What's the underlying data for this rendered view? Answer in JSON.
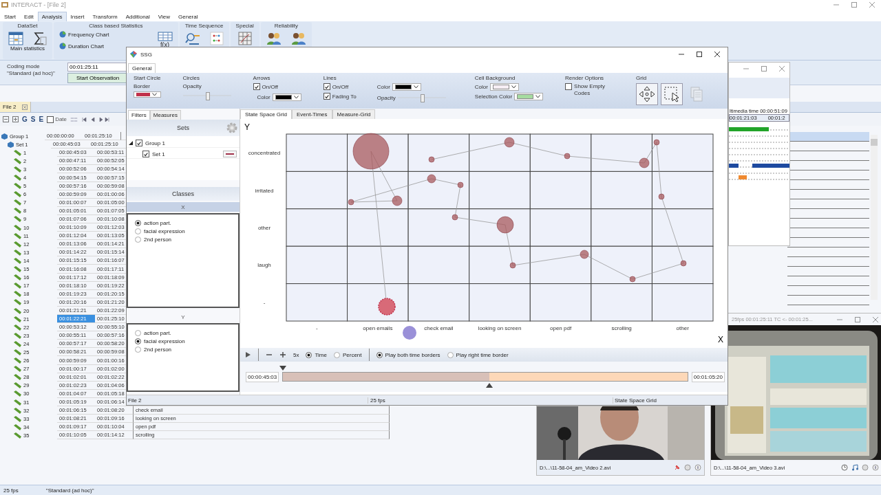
{
  "app": {
    "title": "INTERACT - [File 2]"
  },
  "menu": [
    {
      "label": "Start",
      "selected": false
    },
    {
      "label": "Edit",
      "selected": false
    },
    {
      "label": "Analysis",
      "selected": true
    },
    {
      "label": "Insert",
      "selected": false
    },
    {
      "label": "Transform",
      "selected": false
    },
    {
      "label": "Additional",
      "selected": false
    },
    {
      "label": "View",
      "selected": false
    },
    {
      "label": "General",
      "selected": false
    }
  ],
  "ribbon": [
    {
      "title": "DataSet",
      "caption": "Main statistics",
      "buttons": [
        {
          "kind": "table"
        },
        {
          "kind": "sigma"
        }
      ]
    },
    {
      "title": "Class based Statistics",
      "buttons": [
        {
          "kind": "chart",
          "label": "Frequency Chart"
        },
        {
          "kind": "chart",
          "label": "Duration Chart"
        },
        {
          "kind": "function",
          "label": "f(x)"
        }
      ]
    },
    {
      "title": "Time Sequence",
      "buttons": [
        {
          "kind": "search"
        },
        {
          "kind": "dots"
        }
      ]
    },
    {
      "title": "Special",
      "buttons": [
        {
          "kind": "matrix"
        }
      ]
    },
    {
      "title": "Reliability",
      "buttons": [
        {
          "kind": "people"
        },
        {
          "kind": "people"
        }
      ]
    }
  ],
  "coding": {
    "label": "Coding mode",
    "mode": "\"Standard (ad hoc)\"",
    "time": "00:01:25:11",
    "button": "Start Observation"
  },
  "file_tab": {
    "label": "File 2"
  },
  "toolbar": {
    "buttons": [
      "G",
      "S",
      "E"
    ],
    "date": {
      "label": "Date",
      "checked": false
    }
  },
  "tree": [
    {
      "label": "Group 1",
      "start": "00:00:00:00",
      "end": "00:01:25:10",
      "children": [
        {
          "label": "Set 1",
          "start": "00:00:45:03",
          "end": "00:01:25:10",
          "children": [
            {
              "label": "1",
              "start": "00:00:45:03",
              "end": "00:00:53:11",
              "selected": false
            },
            {
              "label": "2",
              "start": "00:00:47:11",
              "end": "00:00:52:05",
              "selected": false
            },
            {
              "label": "3",
              "start": "00:00:52:06",
              "end": "00:00:54:14",
              "selected": false
            },
            {
              "label": "4",
              "start": "00:00:54:15",
              "end": "00:00:57:15",
              "selected": false
            },
            {
              "label": "5",
              "start": "00:00:57:16",
              "end": "00:00:59:08",
              "selected": false
            },
            {
              "label": "6",
              "start": "00:00:59:09",
              "end": "00:01:00:06",
              "selected": false
            },
            {
              "label": "7",
              "start": "00:01:00:07",
              "end": "00:01:05:00",
              "selected": false
            },
            {
              "label": "8",
              "start": "00:01:05:01",
              "end": "00:01:07:05",
              "selected": false
            },
            {
              "label": "9",
              "start": "00:01:07:06",
              "end": "00:01:10:08",
              "selected": false
            },
            {
              "label": "10",
              "start": "00:01:10:09",
              "end": "00:01:12:03",
              "selected": false
            },
            {
              "label": "11",
              "start": "00:01:12:04",
              "end": "00:01:13:05",
              "selected": false
            },
            {
              "label": "12",
              "start": "00:01:13:06",
              "end": "00:01:14:21",
              "selected": false
            },
            {
              "label": "13",
              "start": "00:01:14:22",
              "end": "00:01:15:14",
              "selected": false
            },
            {
              "label": "14",
              "start": "00:01:15:15",
              "end": "00:01:16:07",
              "selected": false
            },
            {
              "label": "15",
              "start": "00:01:16:08",
              "end": "00:01:17:11",
              "selected": false
            },
            {
              "label": "16",
              "start": "00:01:17:12",
              "end": "00:01:18:09",
              "selected": false
            },
            {
              "label": "17",
              "start": "00:01:18:10",
              "end": "00:01:19:22",
              "selected": false
            },
            {
              "label": "18",
              "start": "00:01:19:23",
              "end": "00:01:20:15",
              "selected": false
            },
            {
              "label": "19",
              "start": "00:01:20:16",
              "end": "00:01:21:20",
              "selected": false
            },
            {
              "label": "20",
              "start": "00:01:21:21",
              "end": "00:01:22:09",
              "selected": false
            },
            {
              "label": "21",
              "start": "00:01:22:21",
              "end": "00:01:25:10",
              "selected": true
            },
            {
              "label": "22",
              "start": "00:00:53:12",
              "end": "00:00:55:10",
              "selected": false
            },
            {
              "label": "23",
              "start": "00:00:55:11",
              "end": "00:00:57:16",
              "selected": false
            },
            {
              "label": "24",
              "start": "00:00:57:17",
              "end": "00:00:58:20",
              "selected": false
            },
            {
              "label": "25",
              "start": "00:00:58:21",
              "end": "00:00:59:08",
              "selected": false
            },
            {
              "label": "26",
              "start": "00:00:59:09",
              "end": "00:01:00:16",
              "selected": false
            },
            {
              "label": "27",
              "start": "00:01:00:17",
              "end": "00:01:02:00",
              "selected": false
            },
            {
              "label": "28",
              "start": "00:01:02:01",
              "end": "00:01:02:22",
              "selected": false
            },
            {
              "label": "29",
              "start": "00:01:02:23",
              "end": "00:01:04:06",
              "selected": false
            },
            {
              "label": "30",
              "start": "00:01:04:07",
              "end": "00:01:05:18",
              "selected": false
            },
            {
              "label": "31",
              "start": "00:01:05:19",
              "end": "00:01:06:14",
              "selected": false
            },
            {
              "label": "32",
              "start": "00:01:06:15",
              "end": "00:01:08:20",
              "column_3": "check email",
              "selected": false
            },
            {
              "label": "33",
              "start": "00:01:08:21",
              "end": "00:01:09:16",
              "column_3": "looking on screen",
              "selected": false
            },
            {
              "label": "34",
              "start": "00:01:09:17",
              "end": "00:01:10:04",
              "column_3": "open pdf",
              "selected": false
            },
            {
              "label": "35",
              "start": "00:01:10:05",
              "end": "00:01:14:12",
              "column_3": "scrolling",
              "selected": false
            }
          ]
        }
      ]
    }
  ],
  "status_bar": [
    "25 fps",
    "\"Standard (ad hoc)\""
  ],
  "timeline_window": {
    "media_time": "ltimedia time 00:00:51:09",
    "ruler": [
      "00:01:21:03",
      "00:01:2"
    ]
  },
  "video_2": {
    "file": "D:\\...\\11-58-04_am_Video 2.avi"
  },
  "video_3": {
    "title": "25fps 00:01:25:11 TC <- 00:01:25...",
    "file": "D:\\...\\11-58-04_am_Video 3.avi"
  },
  "ssg": {
    "title": "SSG",
    "tabs": [
      {
        "label": "General",
        "selected": true
      }
    ],
    "start_circle": {
      "title": "Start Circle",
      "border_label": "Border",
      "border": {
        "color": "#c0304a"
      }
    },
    "circles": {
      "title": "Circles",
      "opacity_label": "Opacity",
      "opacity": {
        "level": 0.5
      }
    },
    "arrows": {
      "title": "Arrows",
      "on_off": {
        "label": "On/Off",
        "checked": true
      },
      "color_label": "Color",
      "color": "#000000"
    },
    "lines": {
      "title": "Lines",
      "on_off": {
        "label": "On/Off",
        "checked": true
      },
      "fading": {
        "label": "Fading To",
        "checked": true
      },
      "color_label": "Color",
      "color": "#000000",
      "opacity_label": "Opacity",
      "opacity": {
        "level": 0.5
      }
    },
    "cell_background": {
      "title": "Cell Background",
      "color_label": "Color",
      "color": "#f6eef4",
      "selection_label": "Selection Color",
      "selection": {
        "color": "#a6dca0"
      }
    },
    "render": {
      "title": "Render Options",
      "show_empty": {
        "label": "Show Empty Codes",
        "checked": false
      }
    },
    "grid": {
      "title": "Grid",
      "buttons": [
        {
          "kind": "move",
          "disabled": false
        },
        {
          "kind": "select",
          "disabled": false
        },
        {
          "kind": "copy",
          "disabled": true
        }
      ]
    },
    "left_tabs": [
      {
        "label": "Filters",
        "selected": true
      },
      {
        "label": "Measures",
        "selected": false
      }
    ],
    "sets": {
      "title": "Sets",
      "tree": [
        {
          "label": "Group 1",
          "checked": true,
          "expanded": true,
          "children": [
            {
              "label": "Set 1",
              "checked": true,
              "color": "#a03048"
            }
          ]
        }
      ]
    },
    "classes": {
      "title": "Classes",
      "axes": [
        {
          "title": "X",
          "options": [
            {
              "label": "action part.",
              "selected": true
            },
            {
              "label": "facial expression",
              "selected": false
            },
            {
              "label": "2nd person",
              "selected": false
            }
          ]
        },
        {
          "title": "Y",
          "options": [
            {
              "label": "action part.",
              "selected": false
            },
            {
              "label": "facial expression",
              "selected": true
            },
            {
              "label": "2nd person",
              "selected": false
            }
          ]
        }
      ]
    },
    "right_tabs": [
      {
        "label": "State Space Grid",
        "selected": true
      },
      {
        "label": "Event-Times",
        "selected": false
      },
      {
        "label": "Measure-Grid",
        "selected": false
      }
    ],
    "grid_chart": {
      "y_title": "Y",
      "x_title": "X",
      "y_labels": [
        "concentrated",
        "irritated",
        "other",
        "laugh",
        "-"
      ],
      "x_labels": [
        "-",
        "open emails",
        "check email",
        "looking on screen",
        "open pdf",
        "scrolling",
        "other"
      ]
    },
    "player": {
      "speed": "5x",
      "modes": [
        {
          "label": "Time",
          "selected": true
        },
        {
          "label": "Percent",
          "selected": false
        }
      ],
      "borders": [
        {
          "label": "Play both time borders",
          "selected": true
        },
        {
          "label": "Play right time border",
          "selected": false
        }
      ],
      "start": "00:00:45:03",
      "end": "00:01:05:20",
      "position": {
        "level": 0.51
      }
    },
    "status": [
      "File 2",
      "25 fps",
      "State Space Grid"
    ]
  }
}
